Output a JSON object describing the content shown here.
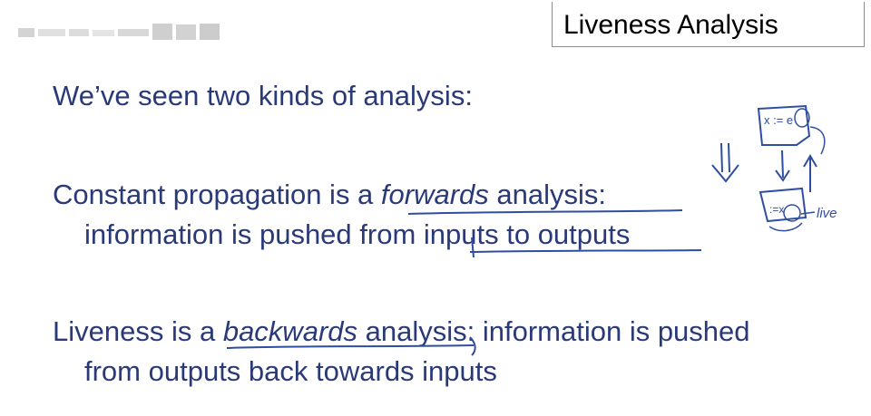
{
  "slide": {
    "title": "Liveness Analysis",
    "line1": "We’ve seen two kinds of analysis:",
    "line2": {
      "pre": "Constant propagation is a ",
      "italic": "forwards",
      "post": " analysis:"
    },
    "line3": "information is pushed from inputs to outputs",
    "line4": {
      "pre": "Liveness is a ",
      "italic": "backwards",
      "post": " analysis: information is pushed"
    },
    "line5": "from outputs back towards inputs"
  },
  "annotations": {
    "box_label": "x := e",
    "use_label": ":=x",
    "live_label": "live"
  },
  "colors": {
    "text": "#2a3a78",
    "ink": "#2f4ea0",
    "title_border": "#8c8c8c"
  }
}
